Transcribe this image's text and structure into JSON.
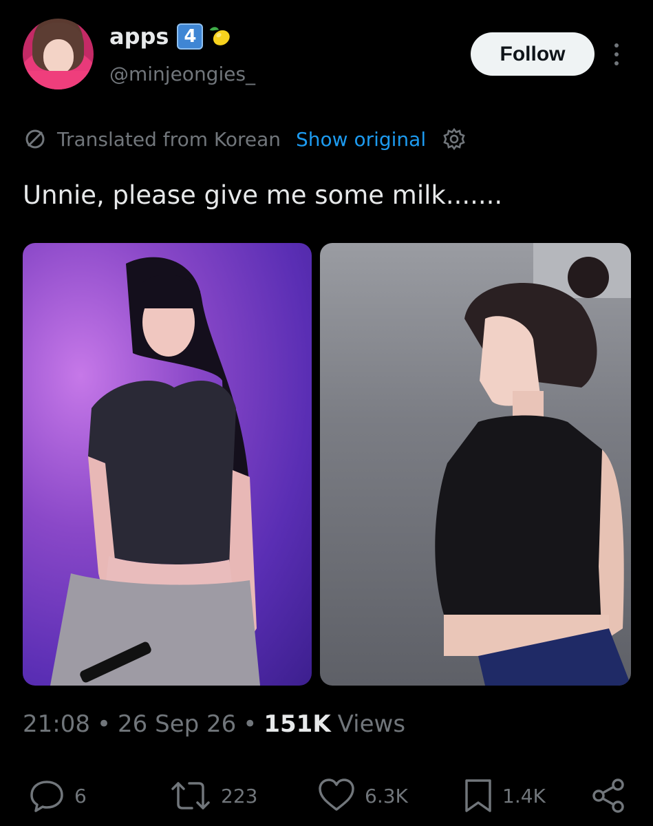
{
  "author": {
    "display_name": "apps",
    "badge_number": "4",
    "badge_emoji": "lemon-icon",
    "handle": "@minjeongies_"
  },
  "header": {
    "follow_label": "Follow",
    "more_icon": "more-vertical-icon"
  },
  "translation": {
    "label": "Translated from Korean",
    "show_original": "Show original",
    "icon": "translate-icon",
    "settings_icon": "gear-icon"
  },
  "tweet": {
    "text": "Unnie, please give me some milk......."
  },
  "media": [
    {
      "icon": "photo-image"
    },
    {
      "icon": "photo-image"
    }
  ],
  "meta": {
    "time": "21:08",
    "date": "26 Sep 26",
    "views_count": "151K",
    "views_label": "Views",
    "separator": "•"
  },
  "actions": {
    "replies": "6",
    "reposts": "223",
    "likes": "6.3K",
    "bookmarks": "1.4K"
  },
  "colors": {
    "background": "#000000",
    "text": "#e7e9ea",
    "muted": "#71767b",
    "accent": "#1d9bf0",
    "follow_bg": "#eff3f4"
  }
}
